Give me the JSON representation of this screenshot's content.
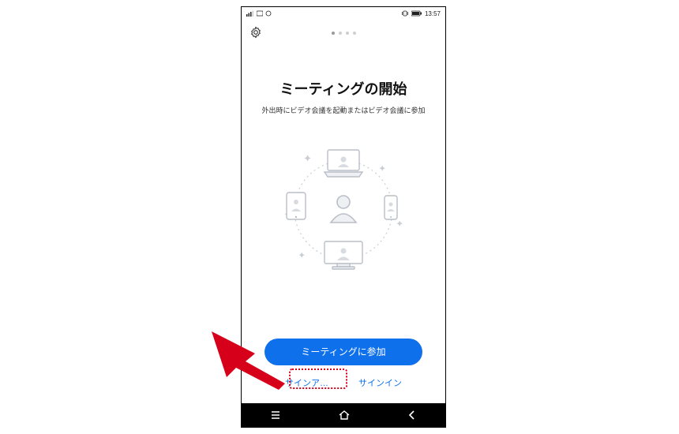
{
  "status": {
    "time": "13:57"
  },
  "hero": {
    "title": "ミーティングの開始",
    "subtitle": "外出時にビデオ会議を起動またはビデオ会議に参加"
  },
  "actions": {
    "join_label": "ミーティングに参加",
    "signup_label": "サインア…",
    "signin_label": "サインイン"
  },
  "icons": {
    "gear": "gear-icon",
    "signal": "signal-icon",
    "battery": "battery-icon",
    "vibrate": "vibrate-icon",
    "nav_menu": "menu-icon",
    "nav_home": "home-icon",
    "nav_back": "back-icon"
  }
}
